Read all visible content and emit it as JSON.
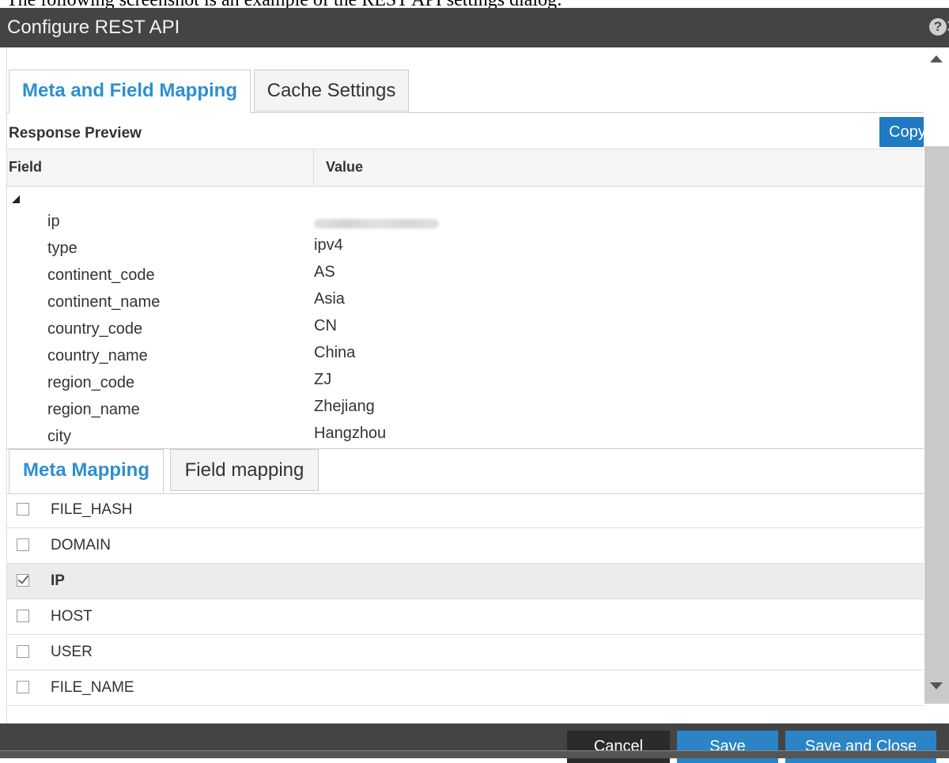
{
  "caption": "The following screenshot is an example of the REST API settings dialog:",
  "dialog": {
    "title": "Configure REST API",
    "help_icon": "?",
    "close_icon": "×"
  },
  "top_tabs": [
    {
      "label": "Meta and Field Mapping",
      "active": true
    },
    {
      "label": "Cache Settings",
      "active": false
    }
  ],
  "response_preview": {
    "label": "Response Preview",
    "copy_button": "Copy",
    "columns": {
      "field": "Field",
      "value": "Value"
    },
    "rows": [
      {
        "field": "ip",
        "value": "",
        "blurred": true
      },
      {
        "field": "type",
        "value": "ipv4"
      },
      {
        "field": "continent_code",
        "value": "AS"
      },
      {
        "field": "continent_name",
        "value": "Asia"
      },
      {
        "field": "country_code",
        "value": "CN"
      },
      {
        "field": "country_name",
        "value": "China"
      },
      {
        "field": "region_code",
        "value": "ZJ"
      },
      {
        "field": "region_name",
        "value": "Zhejiang"
      },
      {
        "field": "city",
        "value": "Hangzhou"
      }
    ]
  },
  "bottom_tabs": [
    {
      "label": "Meta Mapping",
      "active": true
    },
    {
      "label": "Field mapping",
      "active": false
    }
  ],
  "meta_list": [
    {
      "label": "FILE_HASH",
      "checked": false
    },
    {
      "label": "DOMAIN",
      "checked": false
    },
    {
      "label": "IP",
      "checked": true
    },
    {
      "label": "HOST",
      "checked": false
    },
    {
      "label": "USER",
      "checked": false
    },
    {
      "label": "FILE_NAME",
      "checked": false
    }
  ],
  "footer": {
    "cancel": "Cancel",
    "save": "Save",
    "save_close": "Save and Close"
  },
  "colors": {
    "accent": "#2a84c6",
    "active_tab_text": "#2d8fcf",
    "titlebar": "#444444"
  }
}
